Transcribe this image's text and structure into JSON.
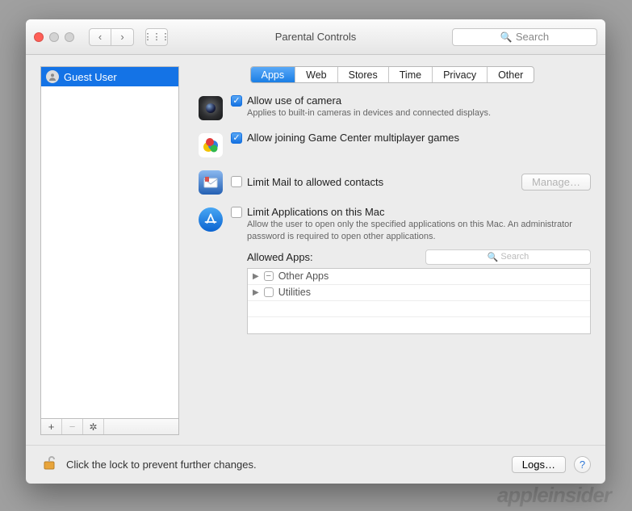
{
  "window": {
    "title": "Parental Controls"
  },
  "toolbar": {
    "search_placeholder": "Search"
  },
  "sidebar": {
    "users": [
      {
        "name": "Guest User"
      }
    ],
    "footer_add": "+",
    "footer_remove": "−",
    "footer_gear": "✲"
  },
  "tabs": {
    "items": [
      {
        "label": "Apps",
        "selected": true
      },
      {
        "label": "Web"
      },
      {
        "label": "Stores"
      },
      {
        "label": "Time"
      },
      {
        "label": "Privacy"
      },
      {
        "label": "Other"
      }
    ]
  },
  "settings": {
    "camera": {
      "label": "Allow use of camera",
      "checked": true,
      "desc": "Applies to built-in cameras in devices and connected displays."
    },
    "gamecenter": {
      "label": "Allow joining Game Center multiplayer games",
      "checked": true
    },
    "mail": {
      "label": "Limit Mail to allowed contacts",
      "checked": false,
      "manage_btn": "Manage…"
    },
    "apps": {
      "label": "Limit Applications on this Mac",
      "checked": false,
      "desc": "Allow the user to open only the specified applications on this Mac. An administrator password is required to open other applications."
    },
    "allowed": {
      "heading": "Allowed Apps:",
      "search_placeholder": "Search",
      "items": [
        {
          "name": "Other Apps",
          "state": "mixed"
        },
        {
          "name": "Utilities",
          "state": "unchecked"
        }
      ]
    }
  },
  "footer": {
    "lock_text": "Click the lock to prevent further changes.",
    "logs_btn": "Logs…"
  },
  "watermark": "appleinsider"
}
